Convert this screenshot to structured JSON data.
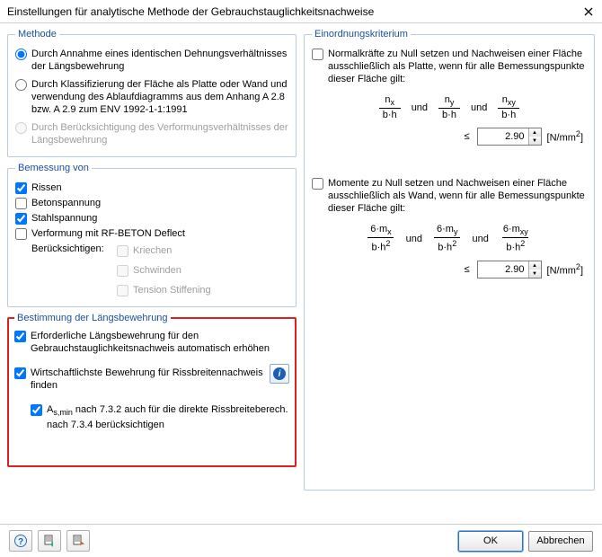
{
  "title": "Einstellungen für analytische Methode der Gebrauchstauglichkeitsnachweise",
  "method": {
    "legend": "Methode",
    "opt1": "Durch Annahme eines identischen Dehnungsverhältnisses der Längsbewehrung",
    "opt2": "Durch Klassifizierung der Fläche als Platte oder Wand und verwendung des Ablaufdiagramms aus dem Anhang A 2.8 bzw. A 2.9 zum ENV 1992-1-1:1991",
    "opt3": "Durch Berücksichtigung des Verformungs­verhältnisses der Längsbewehrung"
  },
  "bemessung": {
    "legend": "Bemessung von",
    "rissen": "Rissen",
    "beton": "Betonspannung",
    "stahl": "Stahlspannung",
    "verformung": "Verformung mit RF-BETON Deflect",
    "berk_label": "Berücksichtigen:",
    "kriechen": "Kriechen",
    "schwinden": "Schwinden",
    "tension": "Tension Stiffening"
  },
  "bestimmung": {
    "legend": "Bestimmung der Längsbewehrung",
    "c1": "Erforderliche Längsbewehrung für den Gebrauchstauglichkeitsnachweis automatisch erhöhen",
    "c2": "Wirtschaftlichste Bewehrung für Rissbreitennachweis finden",
    "c3_pre": "A",
    "c3_sub": "s,min",
    "c3_rest": " nach 7.3.2 auch für die direkte Rissbreiteberech. nach 7.3.4 berücksichtigen"
  },
  "einord": {
    "legend": "Einordnungskriterium",
    "p1": "Normalkräfte zu Null setzen und Nachweisen einer Fläche ausschließlich als Platte, wenn für alle Bemessungspunkte dieser Fläche gilt:",
    "p2": "Momente zu Null setzen und Nachweisen einer Fläche ausschließlich als Wand, wenn für alle Bemessungspunkte dieser Fläche gilt:",
    "und": "und",
    "limit1": "2.90",
    "limit2": "2.90",
    "unit_pre": "[N/mm",
    "unit_post": "]"
  },
  "f1": {
    "n1": "n",
    "s1": "x",
    "d": "b·h",
    "n2": "n",
    "s2": "y",
    "n3": "n",
    "s3": "xy"
  },
  "f2": {
    "n1": "6·m",
    "s1": "x",
    "d": "b·h",
    "n2": "6·m",
    "s2": "y",
    "n3": "6·m",
    "s3": "xy"
  },
  "buttons": {
    "ok": "OK",
    "cancel": "Abbrechen"
  }
}
